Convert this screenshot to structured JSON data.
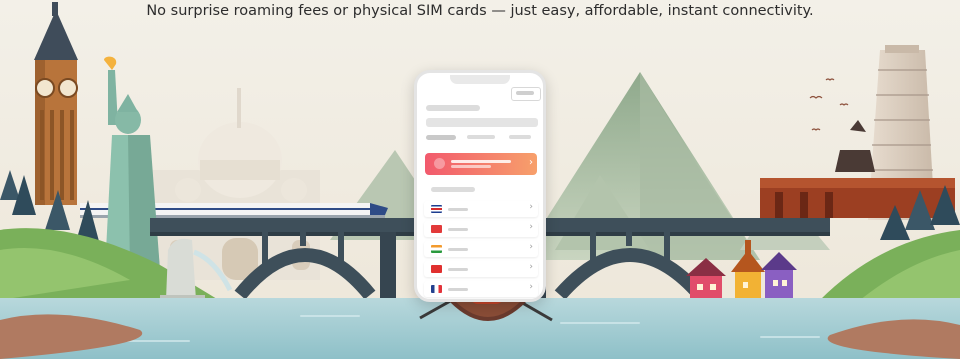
{
  "tagline": "No surprise roaming fees or physical SIM cards — just easy, affordable, instant connectivity.",
  "colors": {
    "sky": "#f3f0e8",
    "water": "#9cc8cf",
    "bridge": "#3e4f5a",
    "mountain": "#9ab59a",
    "promo_start": "#f25a6d",
    "promo_end": "#f7a06b",
    "boat": "#6b3b2e",
    "rower_shirt": "#c2442a"
  },
  "landmarks": [
    "big-ben-icon",
    "statue-of-liberty-icon",
    "taj-mahal-icon",
    "bullet-train-icon",
    "merlion-icon",
    "leaning-tower-of-pisa-icon",
    "brandenburg-gate-icon",
    "colorful-houses-icon",
    "birds-icon"
  ],
  "phone": {
    "countries": [
      {
        "flag": "costa-rica-flag-icon"
      },
      {
        "flag": "turkey-flag-icon"
      },
      {
        "flag": "india-flag-icon"
      },
      {
        "flag": "vietnam-flag-icon"
      },
      {
        "flag": "france-flag-icon"
      }
    ]
  }
}
